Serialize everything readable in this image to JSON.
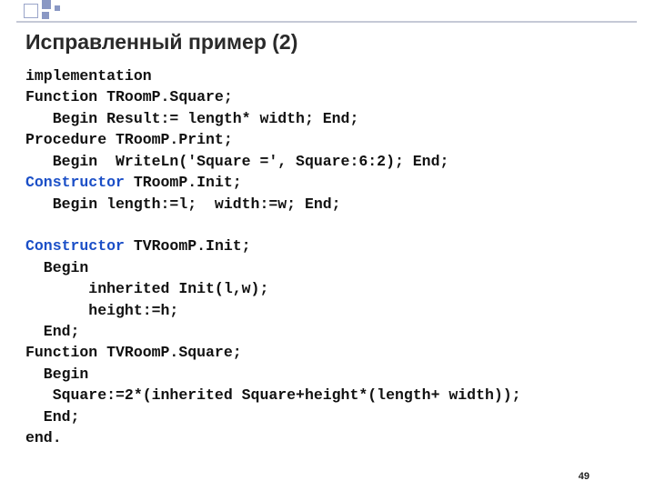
{
  "title": "Исправленный пример (2)",
  "page_number": "49",
  "code": {
    "l01": "implementation",
    "l02": "Function TRoomP.Square;",
    "l03": "   Begin Result:= length* width; End;",
    "l04": "Procedure TRoomP.Print;",
    "l05": "   Begin  WriteLn('Square =', Square:6:2); End;",
    "l06a": "Constructor",
    "l06b": " TRoomP.Init;",
    "l07": "   Begin length:=l;  width:=w; End;",
    "l08": "",
    "l09a": "Constructor",
    "l09b": " TVRoomP.Init;",
    "l10": "  Begin",
    "l11": "       inherited Init(l,w);",
    "l12": "       height:=h;",
    "l13": "  End;",
    "l14": "Function TVRoomP.Square;",
    "l15": "  Begin",
    "l16": "   Square:=2*(inherited Square+height*(length+ width));",
    "l17": "  End;",
    "l18": "end."
  }
}
